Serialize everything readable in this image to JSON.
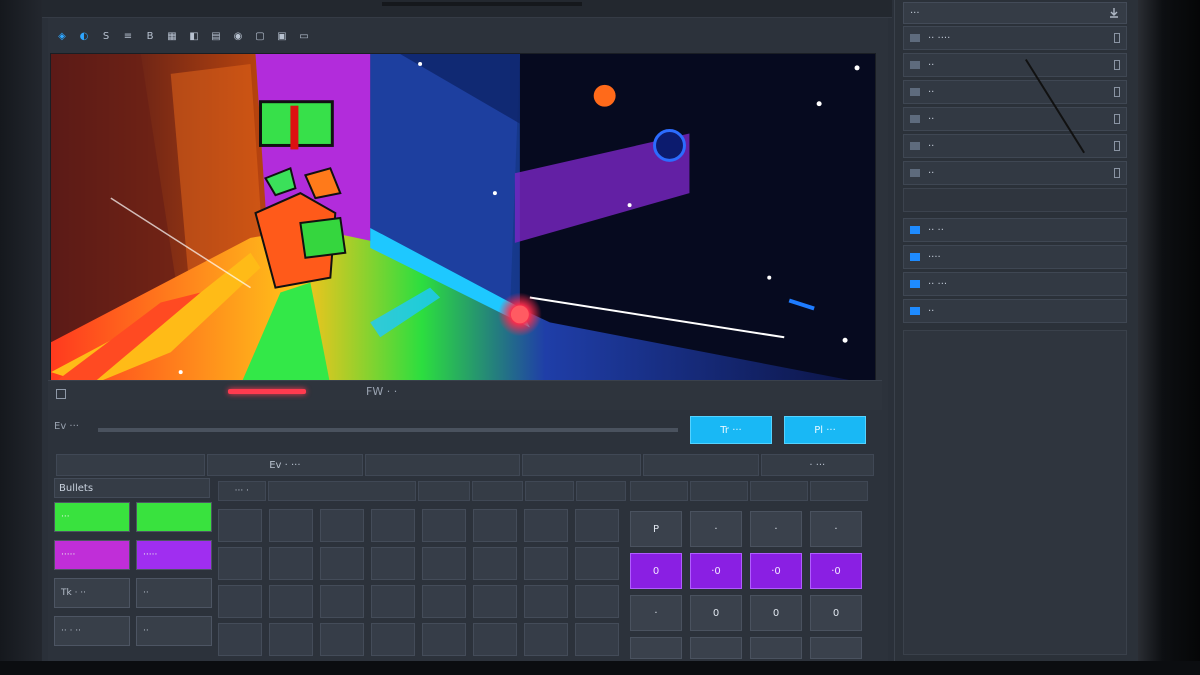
{
  "editor": {
    "toolbar": [
      {
        "name": "select-tool-icon",
        "glyph": "◈",
        "accent": true
      },
      {
        "name": "move-tool-icon",
        "glyph": "◐",
        "accent": true
      },
      {
        "name": "scale-tool-icon",
        "glyph": "S"
      },
      {
        "name": "stack-tool-icon",
        "glyph": "≡"
      },
      {
        "name": "brush-tool-icon",
        "glyph": "B"
      },
      {
        "name": "grid-tool-icon",
        "glyph": "▦"
      },
      {
        "name": "snap-tool-icon",
        "glyph": "◧"
      },
      {
        "name": "layer-tool-icon",
        "glyph": "▤"
      },
      {
        "name": "camera-tool-icon",
        "glyph": "◉"
      },
      {
        "name": "frame-tool-icon",
        "glyph": "▢"
      },
      {
        "name": "play-tool-icon",
        "glyph": "▣"
      },
      {
        "name": "export-tool-icon",
        "glyph": "▭"
      }
    ],
    "scrub_label": "FW ‧ ‧",
    "track_label": "Ev ‧‧‧",
    "buttons": {
      "primary": "Tr ‧‧‧",
      "secondary": "Pl ‧‧‧"
    },
    "tabs": [
      "",
      "Ev ‧ ‧‧‧",
      "",
      "",
      "",
      "‧ ‧‧‧"
    ],
    "palette": {
      "title": "Bullets",
      "swatches": [
        {
          "label": "‧‧‧",
          "color": "#39e23e"
        },
        {
          "label": "",
          "color": "#39e23e"
        },
        {
          "label": "‧‧‧‧‧",
          "color": "#c02ed8"
        },
        {
          "label": "‧‧‧‧‧",
          "color": "#a02ef0"
        },
        {
          "label": "Tk ‧ ‧‧",
          "color": "gray"
        },
        {
          "label": "‧‧",
          "color": "gray"
        },
        {
          "label": "‧‧ ‧ ‧‧",
          "color": "gray"
        },
        {
          "label": "‧‧",
          "color": "gray"
        }
      ]
    },
    "keygrid_head": [
      "‧‧‧ ‧",
      "",
      "",
      "",
      "",
      "",
      "",
      ""
    ],
    "pads_top": [
      "P",
      "‧",
      "‧",
      "‧"
    ],
    "pads_mid": [
      "0",
      "‧0",
      "‧0",
      "‧0"
    ],
    "pads_bot": [
      "‧",
      "0",
      "0",
      "0"
    ]
  },
  "sidebar": {
    "title": "‧‧‧",
    "rows": [
      {
        "label": "‧‧ ‧‧‧‧",
        "blue": false
      },
      {
        "label": "‧‧",
        "blue": false
      },
      {
        "label": "‧‧",
        "blue": false
      },
      {
        "label": "‧‧",
        "blue": false
      },
      {
        "label": "‧‧",
        "blue": false
      },
      {
        "label": "‧‧",
        "blue": false
      }
    ],
    "layer_rows": [
      {
        "label": "‧‧ ‧‧",
        "blue": true
      },
      {
        "label": "‧‧‧‧",
        "blue": true
      },
      {
        "label": "‧‧ ‧‧‧",
        "blue": true
      },
      {
        "label": "‧‧",
        "blue": true
      }
    ]
  }
}
